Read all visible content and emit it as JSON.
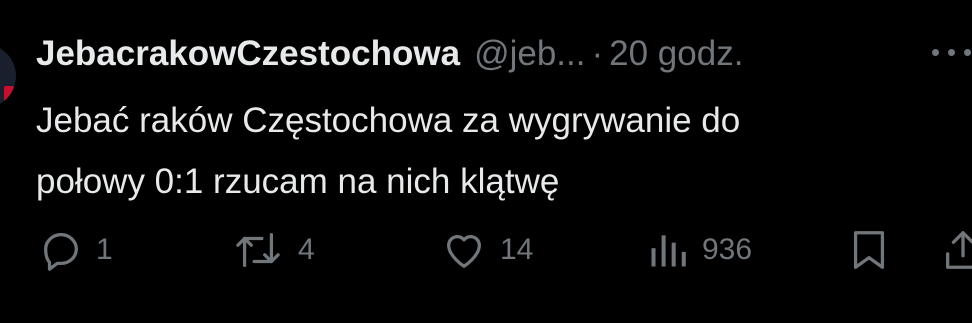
{
  "tweet": {
    "author_name": "JebacrakowCzestochowa",
    "handle": "@jeb...",
    "separator": "·",
    "time": "20 godz.",
    "text_line1": "Jebać raków Częstochowa za wygrywanie do",
    "text_line2": "połowy 0:1 rzucam na nich klątwę"
  },
  "actions": {
    "replies": "1",
    "retweets": "4",
    "likes": "14",
    "views": "936"
  },
  "icons": {
    "reply": "reply-icon",
    "retweet": "retweet-icon",
    "like": "heart-icon",
    "views": "views-icon",
    "bookmark": "bookmark-icon",
    "share": "share-icon",
    "more": "more-icon"
  },
  "colors": {
    "background": "#000000",
    "text": "#e7e9ea",
    "muted": "#71767b"
  }
}
